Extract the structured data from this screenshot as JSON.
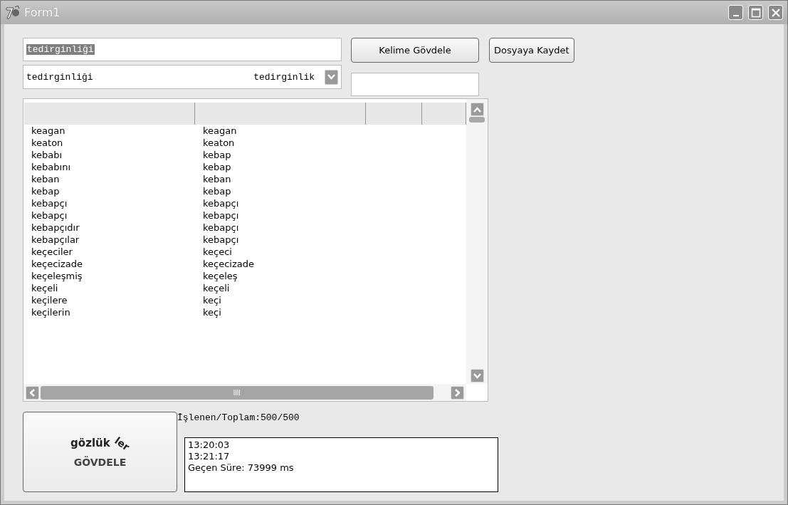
{
  "window": {
    "title": "Form1"
  },
  "word_field": {
    "value": "tedirginliği"
  },
  "result_combo": {
    "word": "tedirginliği",
    "stem": "tedirginlik"
  },
  "buttons": [
    {
      "label": "Kelime Gövdele"
    },
    {
      "label": "Dosyaya Kaydet"
    }
  ],
  "list": {
    "rows": [
      {
        "column_1": "keagan",
        "column_2": "keagan"
      },
      {
        "column_1": "keaton",
        "column_2": "keaton"
      },
      {
        "column_1": "kebabı",
        "column_2": "kebap"
      },
      {
        "column_1": "kebabını",
        "column_2": "kebap"
      },
      {
        "column_1": "keban",
        "column_2": "keban"
      },
      {
        "column_1": "kebap",
        "column_2": "kebap"
      },
      {
        "column_1": "kebapçı",
        "column_2": "kebapçı"
      },
      {
        "column_1": "kebapçı",
        "column_2": "kebapçı"
      },
      {
        "column_1": "kebapçıdır",
        "column_2": "kebapçı"
      },
      {
        "column_1": "kebapçılar",
        "column_2": "kebapçı"
      },
      {
        "column_1": "keçeciler",
        "column_2": "keçeci"
      },
      {
        "column_1": "keçecizade",
        "column_2": "keçecizade"
      },
      {
        "column_1": "keçeleşmiş",
        "column_2": "keçeleş"
      },
      {
        "column_1": "keçeli",
        "column_2": "keçeli"
      },
      {
        "column_1": "keçilere",
        "column_2": "keçi"
      },
      {
        "column_1": "keçilerin",
        "column_2": "keçi"
      }
    ]
  },
  "logo_button": {
    "word": "gözlük",
    "suffix": "ler",
    "label": "GÖVDELE"
  },
  "progress_label": "İşlenen/Toplam:500/500",
  "log": [
    "13:20:03",
    "13:21:17",
    "Geçen Süre: 73999 ms"
  ]
}
